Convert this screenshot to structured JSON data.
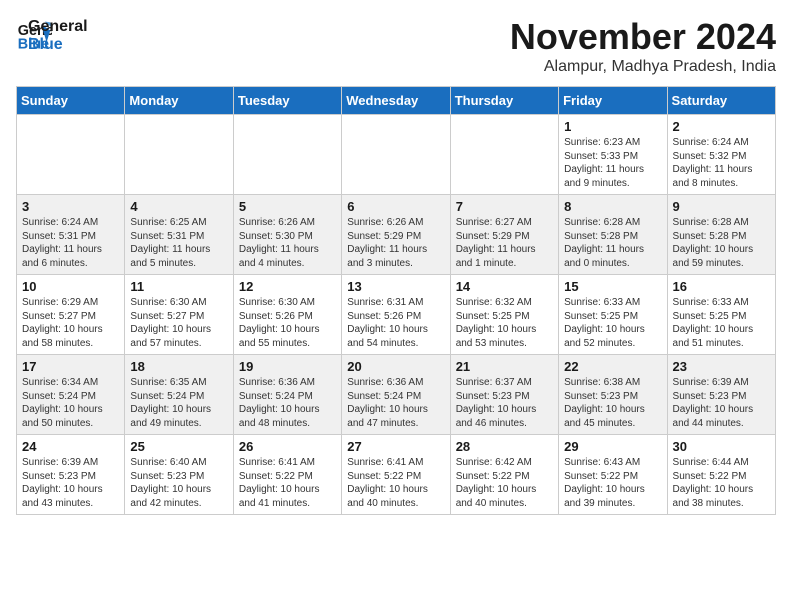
{
  "logo": {
    "line1": "General",
    "line2": "Blue"
  },
  "title": "November 2024",
  "location": "Alampur, Madhya Pradesh, India",
  "days_of_week": [
    "Sunday",
    "Monday",
    "Tuesday",
    "Wednesday",
    "Thursday",
    "Friday",
    "Saturday"
  ],
  "weeks": [
    [
      {
        "day": "",
        "info": ""
      },
      {
        "day": "",
        "info": ""
      },
      {
        "day": "",
        "info": ""
      },
      {
        "day": "",
        "info": ""
      },
      {
        "day": "",
        "info": ""
      },
      {
        "day": "1",
        "info": "Sunrise: 6:23 AM\nSunset: 5:33 PM\nDaylight: 11 hours and 9 minutes."
      },
      {
        "day": "2",
        "info": "Sunrise: 6:24 AM\nSunset: 5:32 PM\nDaylight: 11 hours and 8 minutes."
      }
    ],
    [
      {
        "day": "3",
        "info": "Sunrise: 6:24 AM\nSunset: 5:31 PM\nDaylight: 11 hours and 6 minutes."
      },
      {
        "day": "4",
        "info": "Sunrise: 6:25 AM\nSunset: 5:31 PM\nDaylight: 11 hours and 5 minutes."
      },
      {
        "day": "5",
        "info": "Sunrise: 6:26 AM\nSunset: 5:30 PM\nDaylight: 11 hours and 4 minutes."
      },
      {
        "day": "6",
        "info": "Sunrise: 6:26 AM\nSunset: 5:29 PM\nDaylight: 11 hours and 3 minutes."
      },
      {
        "day": "7",
        "info": "Sunrise: 6:27 AM\nSunset: 5:29 PM\nDaylight: 11 hours and 1 minute."
      },
      {
        "day": "8",
        "info": "Sunrise: 6:28 AM\nSunset: 5:28 PM\nDaylight: 11 hours and 0 minutes."
      },
      {
        "day": "9",
        "info": "Sunrise: 6:28 AM\nSunset: 5:28 PM\nDaylight: 10 hours and 59 minutes."
      }
    ],
    [
      {
        "day": "10",
        "info": "Sunrise: 6:29 AM\nSunset: 5:27 PM\nDaylight: 10 hours and 58 minutes."
      },
      {
        "day": "11",
        "info": "Sunrise: 6:30 AM\nSunset: 5:27 PM\nDaylight: 10 hours and 57 minutes."
      },
      {
        "day": "12",
        "info": "Sunrise: 6:30 AM\nSunset: 5:26 PM\nDaylight: 10 hours and 55 minutes."
      },
      {
        "day": "13",
        "info": "Sunrise: 6:31 AM\nSunset: 5:26 PM\nDaylight: 10 hours and 54 minutes."
      },
      {
        "day": "14",
        "info": "Sunrise: 6:32 AM\nSunset: 5:25 PM\nDaylight: 10 hours and 53 minutes."
      },
      {
        "day": "15",
        "info": "Sunrise: 6:33 AM\nSunset: 5:25 PM\nDaylight: 10 hours and 52 minutes."
      },
      {
        "day": "16",
        "info": "Sunrise: 6:33 AM\nSunset: 5:25 PM\nDaylight: 10 hours and 51 minutes."
      }
    ],
    [
      {
        "day": "17",
        "info": "Sunrise: 6:34 AM\nSunset: 5:24 PM\nDaylight: 10 hours and 50 minutes."
      },
      {
        "day": "18",
        "info": "Sunrise: 6:35 AM\nSunset: 5:24 PM\nDaylight: 10 hours and 49 minutes."
      },
      {
        "day": "19",
        "info": "Sunrise: 6:36 AM\nSunset: 5:24 PM\nDaylight: 10 hours and 48 minutes."
      },
      {
        "day": "20",
        "info": "Sunrise: 6:36 AM\nSunset: 5:24 PM\nDaylight: 10 hours and 47 minutes."
      },
      {
        "day": "21",
        "info": "Sunrise: 6:37 AM\nSunset: 5:23 PM\nDaylight: 10 hours and 46 minutes."
      },
      {
        "day": "22",
        "info": "Sunrise: 6:38 AM\nSunset: 5:23 PM\nDaylight: 10 hours and 45 minutes."
      },
      {
        "day": "23",
        "info": "Sunrise: 6:39 AM\nSunset: 5:23 PM\nDaylight: 10 hours and 44 minutes."
      }
    ],
    [
      {
        "day": "24",
        "info": "Sunrise: 6:39 AM\nSunset: 5:23 PM\nDaylight: 10 hours and 43 minutes."
      },
      {
        "day": "25",
        "info": "Sunrise: 6:40 AM\nSunset: 5:23 PM\nDaylight: 10 hours and 42 minutes."
      },
      {
        "day": "26",
        "info": "Sunrise: 6:41 AM\nSunset: 5:22 PM\nDaylight: 10 hours and 41 minutes."
      },
      {
        "day": "27",
        "info": "Sunrise: 6:41 AM\nSunset: 5:22 PM\nDaylight: 10 hours and 40 minutes."
      },
      {
        "day": "28",
        "info": "Sunrise: 6:42 AM\nSunset: 5:22 PM\nDaylight: 10 hours and 40 minutes."
      },
      {
        "day": "29",
        "info": "Sunrise: 6:43 AM\nSunset: 5:22 PM\nDaylight: 10 hours and 39 minutes."
      },
      {
        "day": "30",
        "info": "Sunrise: 6:44 AM\nSunset: 5:22 PM\nDaylight: 10 hours and 38 minutes."
      }
    ]
  ]
}
